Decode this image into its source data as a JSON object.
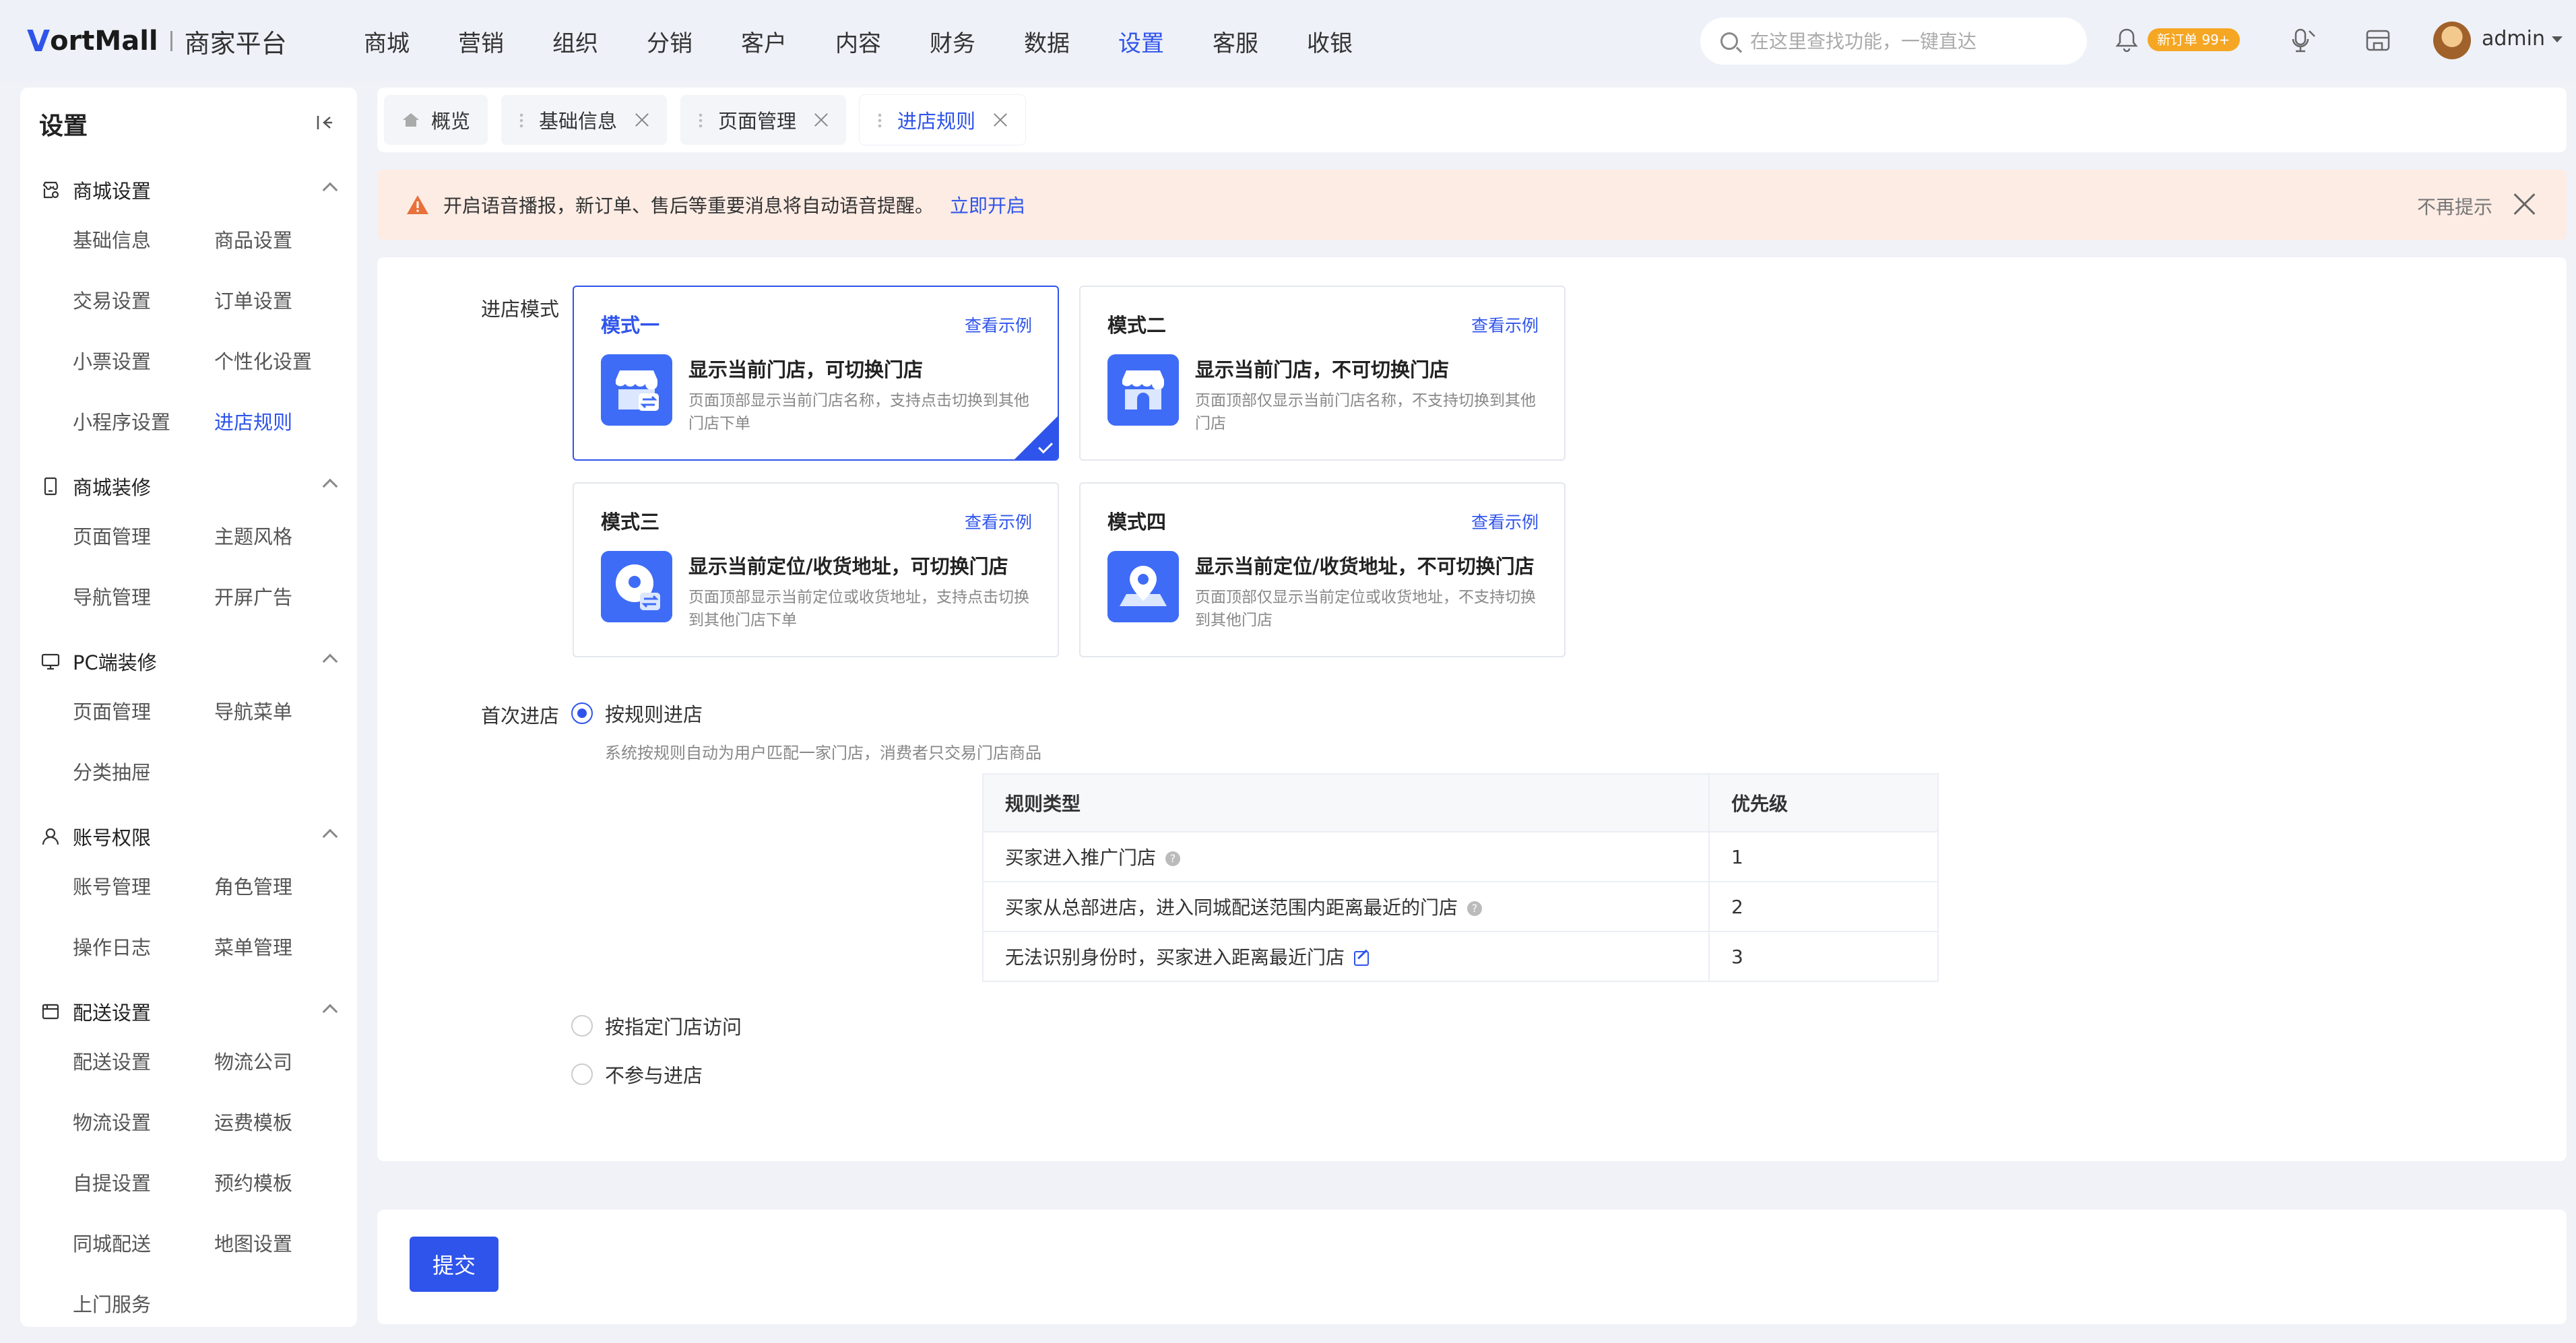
{
  "header": {
    "logo_mark": "V",
    "logo_text": "ortMall",
    "logo_sub": "商家平台",
    "nav": [
      "商城",
      "营销",
      "组织",
      "分销",
      "客户",
      "内容",
      "财务",
      "数据",
      "设置",
      "客服",
      "收银"
    ],
    "active_nav": "设置",
    "search_placeholder": "在这里查找功能，一键直达",
    "order_badge": "新订单 99+",
    "user": "admin"
  },
  "sidebar": {
    "title": "设置",
    "groups": [
      {
        "label": "商城设置",
        "icon": "shop-settings-icon",
        "items": [
          "基础信息",
          "商品设置",
          "交易设置",
          "订单设置",
          "小票设置",
          "个性化设置",
          "小程序设置",
          "进店规则"
        ]
      },
      {
        "label": "商城装修",
        "icon": "tablet-icon",
        "items": [
          "页面管理",
          "主题风格",
          "导航管理",
          "开屏广告"
        ]
      },
      {
        "label": "PC端装修",
        "icon": "monitor-icon",
        "items": [
          "页面管理",
          "导航菜单",
          "分类抽屉"
        ]
      },
      {
        "label": "账号权限",
        "icon": "user-icon",
        "items": [
          "账号管理",
          "角色管理",
          "操作日志",
          "菜单管理"
        ]
      },
      {
        "label": "配送设置",
        "icon": "delivery-icon",
        "items": [
          "配送设置",
          "物流公司",
          "物流设置",
          "运费模板",
          "自提设置",
          "预约模板",
          "同城配送",
          "地图设置",
          "上门服务"
        ]
      }
    ],
    "active_item": "进店规则"
  },
  "tabs": [
    {
      "label": "概览",
      "closable": false,
      "home": true
    },
    {
      "label": "基础信息",
      "closable": true
    },
    {
      "label": "页面管理",
      "closable": true
    },
    {
      "label": "进店规则",
      "closable": true,
      "active": true
    }
  ],
  "notice": {
    "text": "开启语音播报，新订单、售后等重要消息将自动语音提醒。",
    "link": "立即开启",
    "dismiss": "不再提示"
  },
  "form": {
    "mode_label": "进店模式",
    "example_label": "查看示例",
    "modes": [
      {
        "name": "模式一",
        "title": "显示当前门店，可切换门店",
        "desc": "页面顶部显示当前门店名称，支持点击切换到其他门店下单",
        "selected": true
      },
      {
        "name": "模式二",
        "title": "显示当前门店，不可切换门店",
        "desc": "页面顶部仅显示当前门店名称，不支持切换到其他门店",
        "selected": false
      },
      {
        "name": "模式三",
        "title": "显示当前定位/收货地址，可切换门店",
        "desc": "页面顶部显示当前定位或收货地址，支持点击切换到其他门店下单",
        "selected": false
      },
      {
        "name": "模式四",
        "title": "显示当前定位/收货地址，不可切换门店",
        "desc": "页面顶部仅显示当前定位或收货地址，不支持切换到其他门店",
        "selected": false
      }
    ],
    "first_entry_label": "首次进店",
    "option_rule": "按规则进店",
    "option_rule_hint": "系统按规则自动为用户匹配一家门店，消费者只交易门店商品",
    "table": {
      "headers": [
        "规则类型",
        "优先级"
      ],
      "rows": [
        {
          "type": "买家进入推广门店",
          "priority": "1"
        },
        {
          "type": "买家从总部进店，进入同城配送范围内距离最近的门店",
          "priority": "2"
        },
        {
          "type": "无法识别身份时，买家进入距离最近门店",
          "priority": "3"
        }
      ]
    },
    "option_specified": "按指定门店访问",
    "option_none": "不参与进店"
  },
  "submit_label": "提交",
  "colors": {
    "primary": "#2f54eb",
    "notice_bg": "#fdece4",
    "warning": "#e8703a",
    "badge": "#f5a623"
  }
}
